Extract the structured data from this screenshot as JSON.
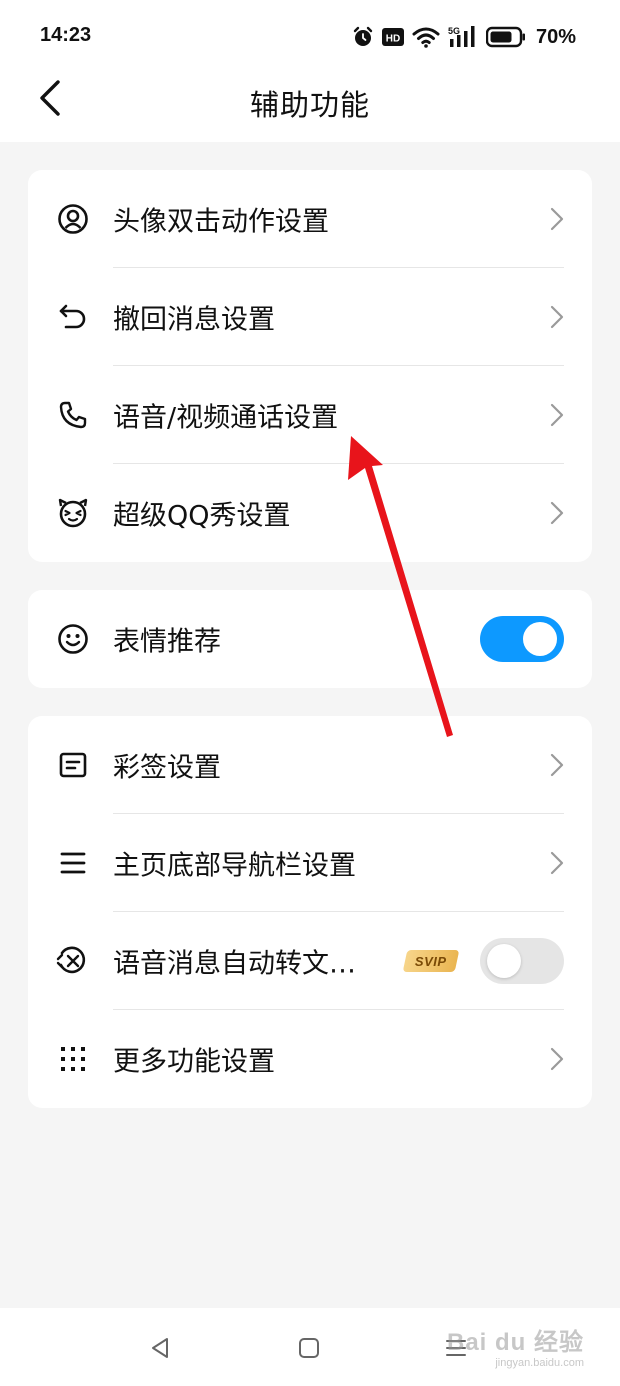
{
  "status_bar": {
    "time": "14:23",
    "icons": [
      "alarm-icon",
      "hd-icon",
      "wifi-icon",
      "signal-5g-icon",
      "battery-icon"
    ],
    "hd_label": "HD",
    "network_label": "5G",
    "battery_percent": "70%"
  },
  "header": {
    "title": "辅助功能",
    "back_icon": "chevron-left-icon"
  },
  "sections": [
    {
      "items": [
        {
          "label": "头像双击动作设置",
          "icon": "avatar-icon",
          "control": "chevron"
        },
        {
          "label": "撤回消息设置",
          "icon": "undo-icon",
          "control": "chevron"
        },
        {
          "label": "语音/视频通话设置",
          "icon": "phone-icon",
          "control": "chevron"
        },
        {
          "label": "超级QQ秀设置",
          "icon": "qq-show-icon",
          "control": "chevron"
        }
      ]
    },
    {
      "items": [
        {
          "label": "表情推荐",
          "icon": "smiley-icon",
          "control": "toggle",
          "enabled": true
        }
      ]
    },
    {
      "items": [
        {
          "label": "彩签设置",
          "icon": "tag-icon",
          "control": "chevron"
        },
        {
          "label": "主页底部导航栏设置",
          "icon": "menu-icon",
          "control": "chevron"
        },
        {
          "label": "语音消息自动转文…",
          "icon": "voice-to-text-icon",
          "control": "toggle",
          "enabled": false,
          "badge": "SVIP"
        },
        {
          "label": "更多功能设置",
          "icon": "grid-dots-icon",
          "control": "chevron"
        }
      ]
    }
  ],
  "nav_bar": {
    "buttons": [
      "back-triangle-icon",
      "home-square-icon",
      "recents-menu-icon"
    ],
    "watermark_main": "Bai du 经验",
    "watermark_sub": "jingyan.baidu.com"
  },
  "colors": {
    "accent": "#0d99ff",
    "background": "#f5f5f5",
    "card": "#ffffff",
    "annotation_arrow": "#e8141b",
    "svip_gold": "#eab551"
  }
}
